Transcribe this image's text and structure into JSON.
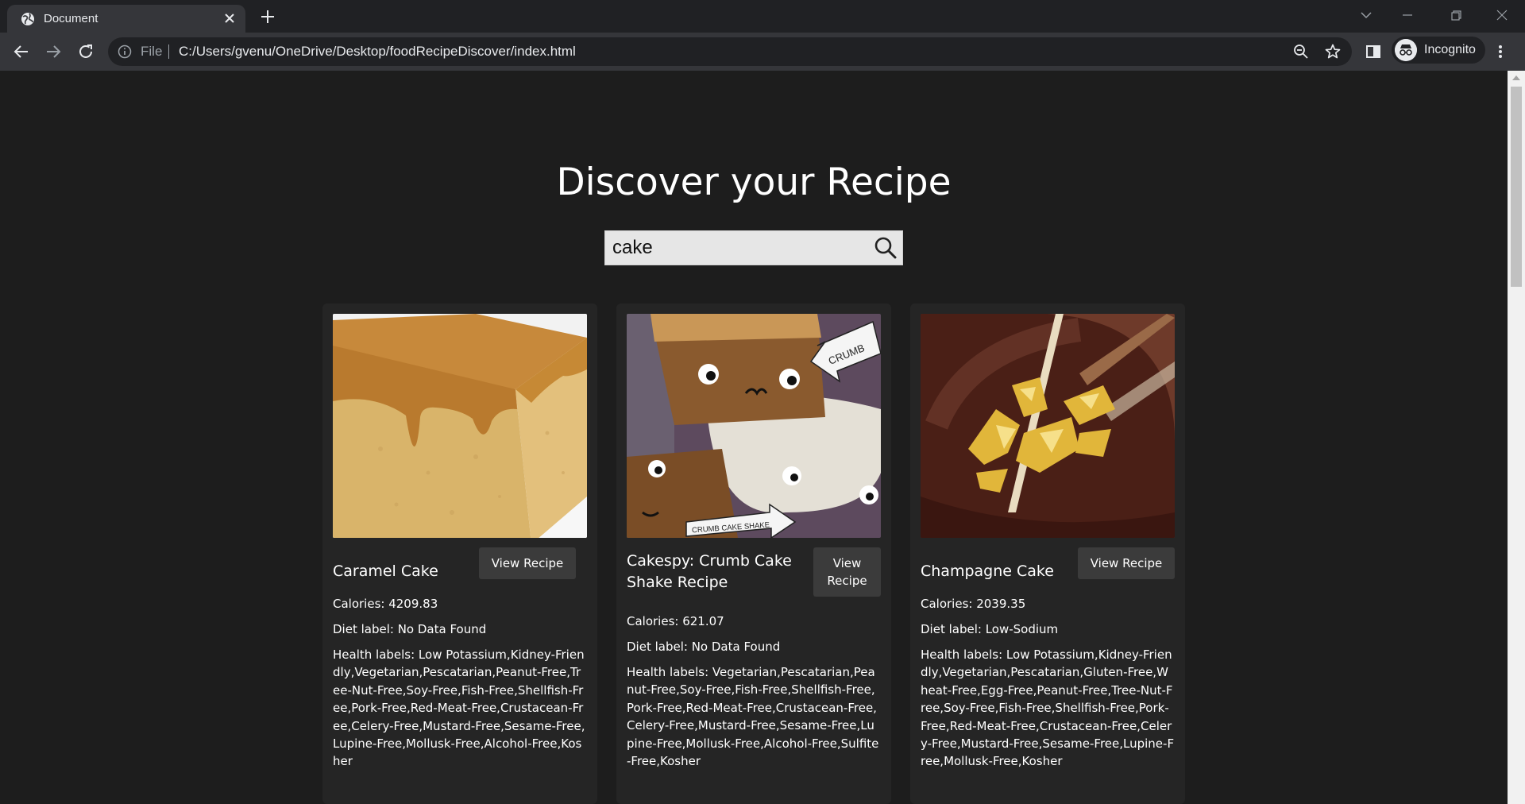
{
  "browser": {
    "tab_title": "Document",
    "file_label": "File",
    "url": "C:/Users/gvenu/OneDrive/Desktop/foodRecipeDiscover/index.html",
    "incognito_label": "Incognito"
  },
  "page": {
    "heading": "Discover your Recipe",
    "search_value": "cake"
  },
  "recipes": [
    {
      "title": "Caramel Cake",
      "button": "View Recipe",
      "calories": "Calories: 4209.83",
      "diet": "Diet label: No Data Found",
      "health": "Health labels: Low Potassium,Kidney-Friendly,Vegetarian,Pescatarian,Peanut-Free,Tree-Nut-Free,Soy-Free,Fish-Free,Shellfish-Free,Pork-Free,Red-Meat-Free,Crustacean-Free,Celery-Free,Mustard-Free,Sesame-Free,Lupine-Free,Mollusk-Free,Alcohol-Free,Kosher"
    },
    {
      "title": "Cakespy: Crumb Cake Shake Recipe",
      "button": "View Recipe",
      "calories": "Calories: 621.07",
      "diet": "Diet label: No Data Found",
      "health": "Health labels: Vegetarian,Pescatarian,Peanut-Free,Soy-Free,Fish-Free,Shellfish-Free,Pork-Free,Red-Meat-Free,Crustacean-Free,Celery-Free,Mustard-Free,Sesame-Free,Lupine-Free,Mollusk-Free,Alcohol-Free,Sulfite-Free,Kosher",
      "image_text_1": "CRUMB",
      "image_text_2": "CRUMB CAKE SHAKE"
    },
    {
      "title": "Champagne Cake",
      "button": "View Recipe",
      "calories": "Calories: 2039.35",
      "diet": "Diet label: Low-Sodium",
      "health": "Health labels: Low Potassium,Kidney-Friendly,Vegetarian,Pescatarian,Gluten-Free,Wheat-Free,Egg-Free,Peanut-Free,Tree-Nut-Free,Soy-Free,Fish-Free,Shellfish-Free,Pork-Free,Red-Meat-Free,Crustacean-Free,Celery-Free,Mustard-Free,Sesame-Free,Lupine-Free,Mollusk-Free,Kosher"
    }
  ],
  "colors": {
    "page_bg": "#1d1d1d",
    "card_bg": "#252525",
    "button_bg": "#3b3b3b",
    "chrome_tab": "#35363a",
    "chrome_frame": "#202124"
  }
}
